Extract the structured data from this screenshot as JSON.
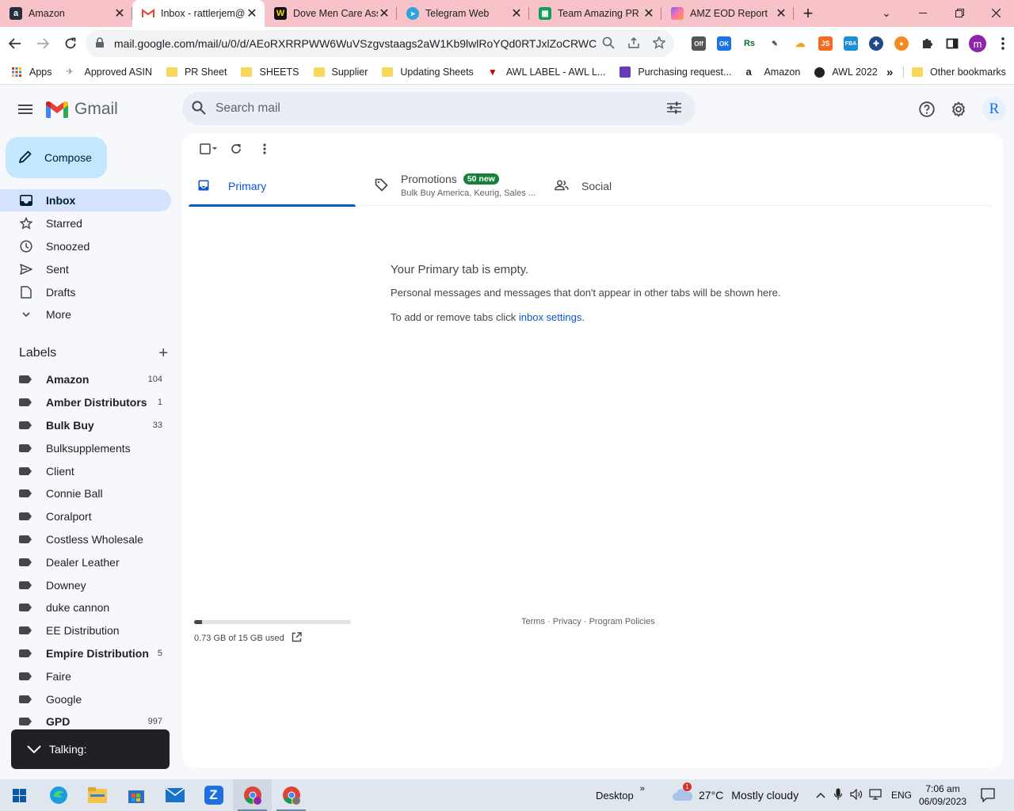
{
  "browser": {
    "tabs": [
      {
        "title": "Amazon",
        "favicon": "amazon-icon",
        "color": "#232f3e",
        "glyph": "a"
      },
      {
        "title": "Inbox - rattlerjem@",
        "favicon": "gmail-icon",
        "color": "#ea4335",
        "glyph": "M"
      },
      {
        "title": "Dove Men Care Ass",
        "favicon": "w-icon",
        "color": "#111111",
        "glyph": "W"
      },
      {
        "title": "Telegram Web",
        "favicon": "telegram-icon",
        "color": "#2aa3e0",
        "glyph": "➤"
      },
      {
        "title": "Team Amazing PR -",
        "favicon": "sheets-icon",
        "color": "#0f9d58",
        "glyph": "▦"
      },
      {
        "title": "AMZ EOD Report",
        "favicon": "clickup-icon",
        "color": "#7b68ee",
        "glyph": "◆"
      }
    ],
    "url": "mail.google.com/mail/u/0/d/AEoRXRRPWW6WuVSzgvstaags2aW1Kb9lwlRoYQd0RTJxlZoCRWCK...",
    "bookmarks": [
      {
        "label": "Apps",
        "icon": "apps-grid-icon"
      },
      {
        "label": "Approved ASIN",
        "icon": "bookmark-page-icon"
      },
      {
        "label": "PR Sheet",
        "icon": "folder-icon"
      },
      {
        "label": "SHEETS",
        "icon": "folder-icon"
      },
      {
        "label": "Supplier",
        "icon": "folder-icon"
      },
      {
        "label": "Updating Sheets",
        "icon": "folder-icon"
      },
      {
        "label": "AWL LABEL - AWL L...",
        "icon": "awl-icon"
      },
      {
        "label": "Purchasing request...",
        "icon": "forms-icon"
      },
      {
        "label": "Amazon",
        "icon": "amazon-icon"
      },
      {
        "label": "AWL 2022",
        "icon": "awl-globe-icon"
      }
    ],
    "more_bookmarks": "»",
    "other_bookmarks": "Other bookmarks",
    "profile_initial": "m"
  },
  "gmail": {
    "brand": "Gmail",
    "search_placeholder": "Search mail",
    "avatar_initial": "R",
    "compose": "Compose",
    "nav": [
      {
        "label": "Inbox",
        "icon": "inbox-icon",
        "active": true
      },
      {
        "label": "Starred",
        "icon": "star-icon"
      },
      {
        "label": "Snoozed",
        "icon": "clock-icon"
      },
      {
        "label": "Sent",
        "icon": "send-icon"
      },
      {
        "label": "Drafts",
        "icon": "draft-icon"
      },
      {
        "label": "More",
        "icon": "chevron-down-icon"
      }
    ],
    "labels_title": "Labels",
    "labels": [
      {
        "name": "Amazon",
        "count": "104",
        "bold": true
      },
      {
        "name": "Amber Distributors",
        "count": "1",
        "bold": true
      },
      {
        "name": "Bulk Buy",
        "count": "33",
        "bold": true
      },
      {
        "name": "Bulksupplements",
        "count": "",
        "bold": false
      },
      {
        "name": "Client",
        "count": "",
        "bold": false
      },
      {
        "name": "Connie Ball",
        "count": "",
        "bold": false
      },
      {
        "name": "Coralport",
        "count": "",
        "bold": false
      },
      {
        "name": "Costless Wholesale",
        "count": "",
        "bold": false
      },
      {
        "name": "Dealer Leather",
        "count": "",
        "bold": false
      },
      {
        "name": "Downey",
        "count": "",
        "bold": false
      },
      {
        "name": "duke cannon",
        "count": "",
        "bold": false
      },
      {
        "name": "EE Distribution",
        "count": "",
        "bold": false
      },
      {
        "name": "Empire Distribution",
        "count": "5",
        "bold": true
      },
      {
        "name": "Faire",
        "count": "",
        "bold": false
      },
      {
        "name": "Google",
        "count": "",
        "bold": false
      },
      {
        "name": "GPD",
        "count": "997",
        "bold": true
      }
    ],
    "talking": "Talking:",
    "tabs": {
      "primary": "Primary",
      "promotions": "Promotions",
      "promotions_badge": "50 new",
      "promotions_senders": "Bulk Buy America, Keurig, Sales ...",
      "social": "Social"
    },
    "empty": {
      "heading": "Your Primary tab is empty.",
      "line1": "Personal messages and messages that don't appear in other tabs will be shown here.",
      "line2_prefix": "To add or remove tabs click ",
      "line2_link": "inbox settings",
      "line2_suffix": "."
    },
    "storage": {
      "text": "0.73 GB of 15 GB used",
      "used_fraction": 0.049
    },
    "footer": {
      "terms": "Terms",
      "privacy": "Privacy",
      "policies": "Program Policies",
      "sep": " · "
    }
  },
  "taskbar": {
    "desktop": "Desktop",
    "weather_temp": "27°C",
    "weather_text": "Mostly cloudy",
    "weather_alert": "1",
    "lang": "ENG",
    "time": "7:06 am",
    "date": "06/09/2023"
  },
  "colors": {
    "accent": "#0b57d0",
    "inbox_active": "#d3e3fd",
    "compose": "#c2e7ff",
    "tabstrip": "#f7c2c8"
  }
}
